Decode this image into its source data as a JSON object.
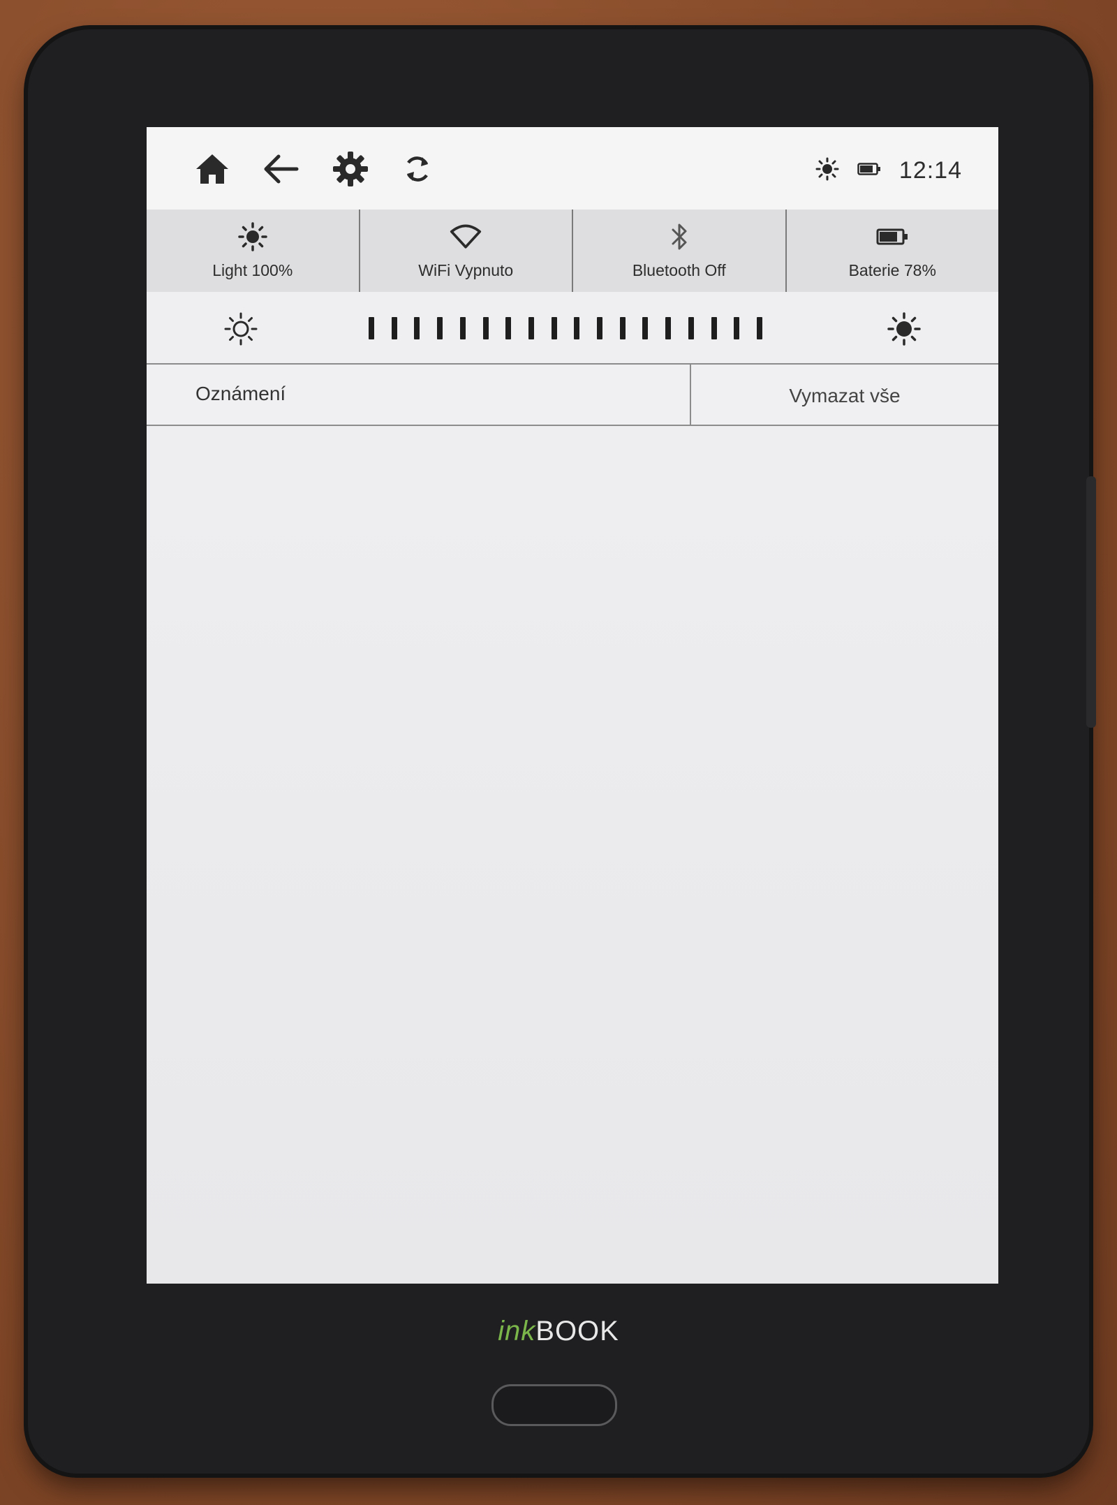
{
  "device": {
    "brand_prefix": "ink",
    "brand_suffix": "BOOK"
  },
  "statusbar": {
    "icons": [
      "home-icon",
      "back-arrow-icon",
      "gear-icon",
      "sync-icon"
    ],
    "indicators": [
      "sun-icon",
      "battery-icon"
    ],
    "time": "12:14"
  },
  "tiles": [
    {
      "icon": "sun-icon",
      "label": "Light 100%"
    },
    {
      "icon": "wifi-icon",
      "label": "WiFi Vypnuto"
    },
    {
      "icon": "bluetooth-icon",
      "label": "Bluetooth Off"
    },
    {
      "icon": "battery-icon",
      "label": "Baterie 78%"
    }
  ],
  "brightness": {
    "level_fraction": 1.0,
    "tick_count": 18
  },
  "notifications": {
    "title": "Oznámení",
    "clear_all_label": "Vymazat vše"
  },
  "colors": {
    "screen": "#ececee",
    "brand_green": "#7bb64a",
    "bezel": "#1f1f21"
  }
}
